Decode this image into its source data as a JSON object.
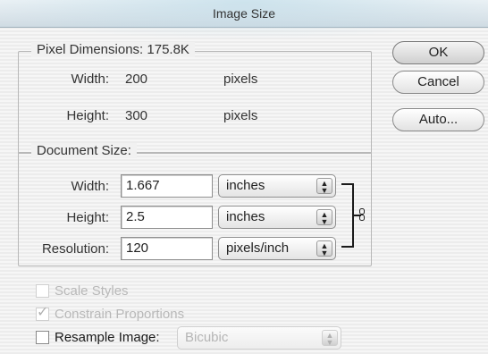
{
  "window": {
    "title": "Image Size"
  },
  "pixel_dimensions": {
    "legend": "Pixel Dimensions:",
    "size": "175.8K",
    "width": {
      "label": "Width:",
      "value": "200",
      "unit": "pixels"
    },
    "height": {
      "label": "Height:",
      "value": "300",
      "unit": "pixels"
    }
  },
  "document_size": {
    "legend": "Document Size:",
    "width": {
      "label": "Width:",
      "value": "1.667",
      "unit": "inches"
    },
    "height": {
      "label": "Height:",
      "value": "2.5",
      "unit": "inches"
    },
    "resolution": {
      "label": "Resolution:",
      "value": "120",
      "unit": "pixels/inch"
    }
  },
  "options": {
    "scale_styles": {
      "label": "Scale Styles",
      "checked": false,
      "enabled": false
    },
    "constrain_proportions": {
      "label": "Constrain Proportions",
      "checked": true,
      "enabled": false
    },
    "resample_image": {
      "label": "Resample Image:",
      "checked": false,
      "enabled": true,
      "method": "Bicubic"
    }
  },
  "buttons": {
    "ok": "OK",
    "cancel": "Cancel",
    "auto": "Auto..."
  },
  "icons": [
    "stepper-arrows-icon",
    "link-chain-icon",
    "checkmark-icon"
  ]
}
